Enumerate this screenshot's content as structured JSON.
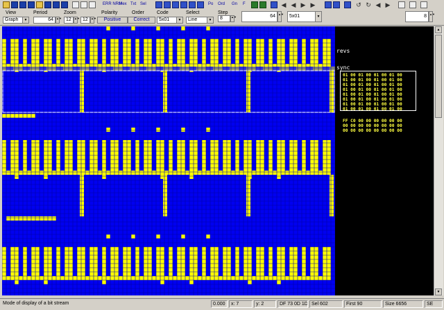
{
  "toolbar": {
    "text_buttons": [
      "ERR NRM",
      "Hex",
      "Txt",
      "Sel",
      "Po",
      "Ord",
      "Gn",
      "F"
    ]
  },
  "controls": {
    "view_label": "View",
    "view_value": "Graph",
    "period_label": "Period",
    "period_value": "64",
    "zoom_label": "Zoom",
    "zoom_x": "12",
    "zoom_y": "12",
    "polarity_label": "Polarity",
    "polarity_value": "Positive",
    "order_label": "Order",
    "order_value": "Correct",
    "code_label": "Code",
    "code_value": "5x01",
    "select_label": "Select",
    "select_value": "Line",
    "step_label": "Step",
    "step_value": "8",
    "period_right_value": "64",
    "code_right_value": "5x01",
    "step_right_value": "8"
  },
  "side_panel": {
    "label_revs": "revs",
    "label_sync": "sync",
    "hex_block_1": [
      "01 00 01 00 01 00 01 00",
      "01 00 01 00 01 00 01 00",
      "01 00 01 00 01 00 01 00",
      "01 00 01 00 01 00 01 00",
      "01 00 01 00 01 00 01 00",
      "01 00 01 00 01 00 01 00",
      "01 00 01 00 01 00 01 00",
      "01 00 01 00 01 00 01 00"
    ],
    "hex_block_2": [
      "FF C0 00 00 00 00 00 00",
      "00 00 00 00 00 00 00 00",
      "00 00 00 00 00 00 00 00"
    ]
  },
  "colors": {
    "bit_on": "#ffff00",
    "bit_off": "#0000f0",
    "grid": "#0000a8",
    "sync_band": "#9a9a6a",
    "hex_text": "#ffff40"
  },
  "status": {
    "hint": "Mode of display of a bit stream",
    "coord_value": "0.000",
    "x": "x: 7",
    "y": "y: 2",
    "bytes": "DF 73 0D 1D",
    "sel": "Sel 602",
    "first": "First 90",
    "size": "Size 6656",
    "mode": "SE"
  }
}
